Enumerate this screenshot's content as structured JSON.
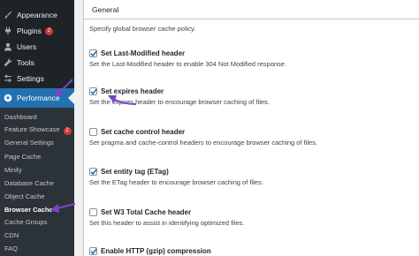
{
  "sidebar": {
    "items": [
      {
        "label": "Appearance",
        "icon": "paintbrush-icon"
      },
      {
        "label": "Plugins",
        "icon": "plug-icon",
        "badge": "2"
      },
      {
        "label": "Users",
        "icon": "user-icon"
      },
      {
        "label": "Tools",
        "icon": "wrench-icon"
      },
      {
        "label": "Settings",
        "icon": "sliders-icon"
      }
    ],
    "active": {
      "label": "Performance",
      "icon": "performance-icon"
    },
    "submenu": [
      {
        "label": "Dashboard"
      },
      {
        "label": "Feature Showcase",
        "badge": "2"
      },
      {
        "label": "General Settings"
      },
      {
        "label": "Page Cache"
      },
      {
        "label": "Minify"
      },
      {
        "label": "Database Cache"
      },
      {
        "label": "Object Cache"
      },
      {
        "label": "Browser Cache",
        "current": true
      },
      {
        "label": "Cache Groups"
      },
      {
        "label": "CDN"
      },
      {
        "label": "FAQ"
      }
    ]
  },
  "panel": {
    "title": "General",
    "intro": "Specify global browser cache policy.",
    "options": [
      {
        "label": "Set Last-Modified header",
        "desc": "Set the Last-Modified header to enable 304 Not Modified response.",
        "checked": true
      },
      {
        "label": "Set expires header",
        "desc": "Set the expires header to encourage browser caching of files.",
        "checked": true
      },
      {
        "label": "Set cache control header",
        "desc": "Set pragma and cache-control headers to encourage browser caching of files.",
        "checked": false
      },
      {
        "label": "Set entity tag (ETag)",
        "desc": "Set the ETag header to encourage browser caching of files.",
        "checked": true
      },
      {
        "label": "Set W3 Total Cache header",
        "desc": "Set this header to assist in identifying optimized files.",
        "checked": false
      },
      {
        "label": "Enable HTTP (gzip) compression",
        "desc": "",
        "checked": true
      }
    ]
  },
  "colors": {
    "sidebar_bg": "#1d2327",
    "submenu_bg": "#2c3338",
    "accent": "#2271b1",
    "badge": "#d63638",
    "annotation": "#7b45c7"
  }
}
